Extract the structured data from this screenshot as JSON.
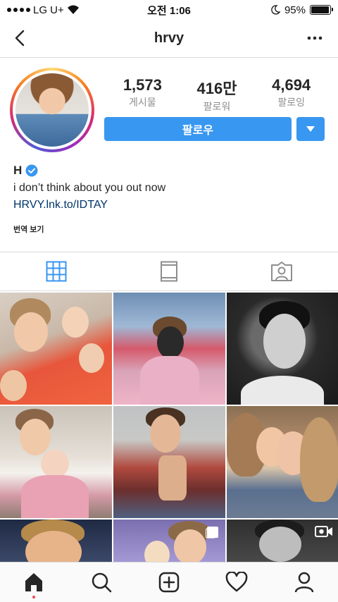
{
  "status_bar": {
    "carrier": "LG U+",
    "time": "오전 1:06",
    "battery": "95%",
    "battery_level": 0.95
  },
  "header": {
    "title": "hrvy",
    "back_icon": "chevron-left-icon",
    "more_icon": "more-dots-icon"
  },
  "profile": {
    "stats": [
      {
        "value": "1,573",
        "label": "게시물"
      },
      {
        "value": "416만",
        "label": "팔로워"
      },
      {
        "value": "4,694",
        "label": "팔로잉"
      }
    ],
    "follow_label": "팔로우",
    "name": "H",
    "bio": "i don’t think about you out now",
    "link": "HRVY.lnk.to/IDTAY",
    "translate": "번역 보기"
  },
  "tabs": [
    {
      "icon": "grid-icon",
      "active": true
    },
    {
      "icon": "feed-icon",
      "active": false
    },
    {
      "icon": "tagged-icon",
      "active": false
    }
  ],
  "bottom_nav": [
    {
      "icon": "home-icon"
    },
    {
      "icon": "search-icon"
    },
    {
      "icon": "add-post-icon"
    },
    {
      "icon": "heart-icon"
    },
    {
      "icon": "profile-icon"
    }
  ],
  "colors": {
    "accent": "#3897f0",
    "active_tab": "#3897f0",
    "link": "#003569"
  }
}
